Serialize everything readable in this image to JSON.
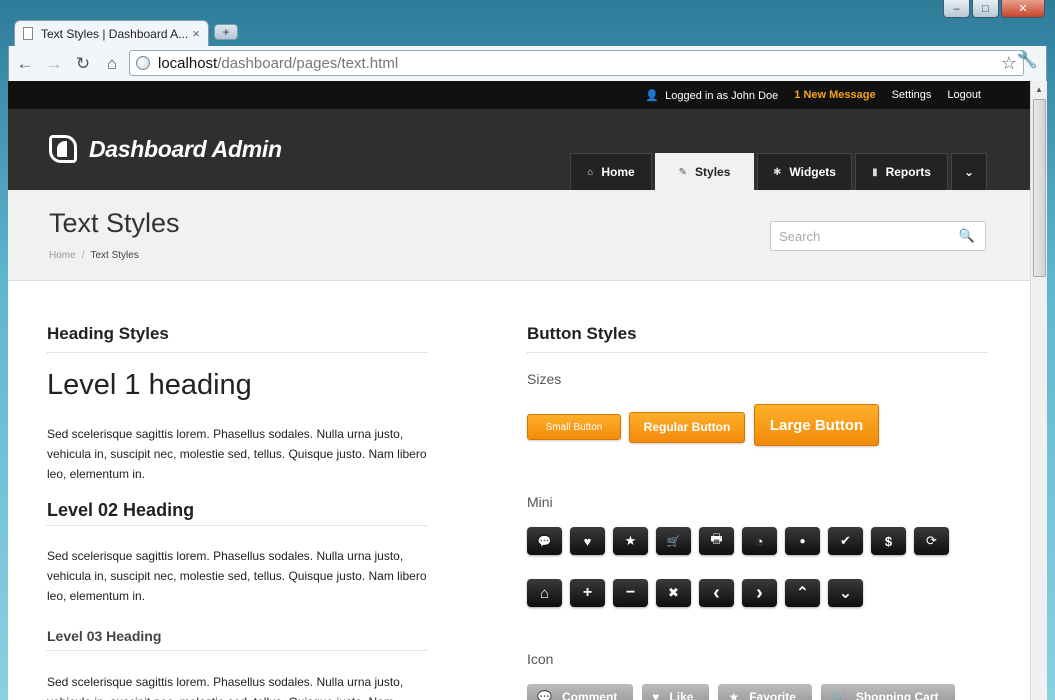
{
  "browser": {
    "tab_title": "Text Styles | Dashboard A...",
    "tab_close": "×",
    "new_tab": "+",
    "url_host": "localhost",
    "url_path": "/dashboard/pages/text.html",
    "window_controls": {
      "minimize": "–",
      "maximize": "□",
      "close": "✕"
    },
    "nav": {
      "back": "←",
      "forward": "→",
      "reload": "↻",
      "home": "⌂",
      "star": "☆",
      "wrench": "🔧"
    }
  },
  "topbar": {
    "user_icon": "👤",
    "logged_in": "Logged in as John Doe",
    "messages": "1 New Message",
    "settings": "Settings",
    "logout": "Logout"
  },
  "header": {
    "logo_text": "Dashboard Admin",
    "nav": [
      {
        "label": "Home",
        "icon": "⌂",
        "icon_name": "home-icon",
        "active": false
      },
      {
        "label": "Styles",
        "icon": "✎",
        "icon_name": "brush-icon",
        "active": true
      },
      {
        "label": "Widgets",
        "icon": "✱",
        "icon_name": "cog-icon",
        "active": false
      },
      {
        "label": "Reports",
        "icon": "▮",
        "icon_name": "bar-chart-icon",
        "active": false
      },
      {
        "label": "",
        "icon": "⌄",
        "icon_name": "chevron-down-icon",
        "active": false
      }
    ]
  },
  "titlebar": {
    "title": "Text Styles",
    "breadcrumb_home": "Home",
    "breadcrumb_sep": "/",
    "breadcrumb_current": "Text Styles",
    "search_placeholder": "Search",
    "search_icon": "🔍"
  },
  "left": {
    "section_title": "Heading Styles",
    "h1": "Level 1 heading",
    "p1": "Sed scelerisque sagittis lorem. Phasellus sodales. Nulla urna justo, vehicula in, suscipit nec, molestie sed, tellus. Quisque justo. Nam libero leo, elementum in.",
    "h2": "Level 02 Heading",
    "p2": "Sed scelerisque sagittis lorem. Phasellus sodales. Nulla urna justo, vehicula in, suscipit nec, molestie sed, tellus. Quisque justo. Nam libero leo, elementum in.",
    "h3": "Level 03 Heading",
    "p3": "Sed scelerisque sagittis lorem. Phasellus sodales. Nulla urna justo, vehicula in, suscipit nec, molestie sed, tellus. Quisque justo. Nam"
  },
  "right": {
    "section_title": "Button Styles",
    "sizes_label": "Sizes",
    "small_button": "Small Button",
    "regular_button": "Regular Button",
    "large_button": "Large Button",
    "mini_label": "Mini",
    "mini_row1": [
      {
        "glyph": "💬",
        "name": "comment-icon"
      },
      {
        "glyph": "♥",
        "name": "heart-icon"
      },
      {
        "glyph": "★",
        "name": "star-icon"
      },
      {
        "glyph": "🛒",
        "name": "cart-icon"
      },
      {
        "glyph": "🖶",
        "name": "print-icon"
      },
      {
        "glyph": "◔",
        "name": "rss-icon"
      },
      {
        "glyph": "●",
        "name": "user-icon"
      },
      {
        "glyph": "✔",
        "name": "check-icon"
      },
      {
        "glyph": "$",
        "name": "dollar-icon"
      },
      {
        "glyph": "⟳",
        "name": "refresh-icon"
      }
    ],
    "mini_row2": [
      {
        "glyph": "⌂",
        "name": "home-icon"
      },
      {
        "glyph": "+",
        "name": "plus-icon"
      },
      {
        "glyph": "−",
        "name": "minus-icon"
      },
      {
        "glyph": "✖",
        "name": "close-icon"
      },
      {
        "glyph": "‹",
        "name": "chevron-left-icon"
      },
      {
        "glyph": "›",
        "name": "chevron-right-icon"
      },
      {
        "glyph": "⌃",
        "name": "chevron-up-icon"
      },
      {
        "glyph": "⌄",
        "name": "chevron-down-icon"
      }
    ],
    "icon_label": "Icon",
    "icon_buttons": [
      {
        "glyph": "💬",
        "label": "Comment",
        "name": "comment-icon"
      },
      {
        "glyph": "♥",
        "label": "Like",
        "name": "heart-icon"
      },
      {
        "glyph": "★",
        "label": "Favorite",
        "name": "star-icon"
      },
      {
        "glyph": "🛒",
        "label": "Shopping Cart",
        "name": "cart-icon"
      }
    ]
  },
  "colors": {
    "accent_orange": "#f7a21a",
    "header_dark": "#2f2f2f",
    "topbar_black": "#111111"
  }
}
